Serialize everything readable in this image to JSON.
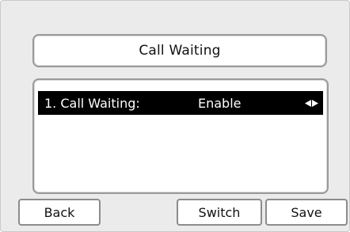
{
  "title": "Call Waiting",
  "menu": {
    "items": [
      {
        "label": "1. Call Waiting:",
        "value": "Enable",
        "selected": true,
        "arrows_icon": "left-right-arrows-icon"
      }
    ]
  },
  "softkeys": {
    "back": "Back",
    "switch": "Switch",
    "save": "Save"
  },
  "colors": {
    "highlight_bg": "#000000",
    "highlight_text": "#ffffff",
    "screen_bg": "#ebebeb"
  }
}
